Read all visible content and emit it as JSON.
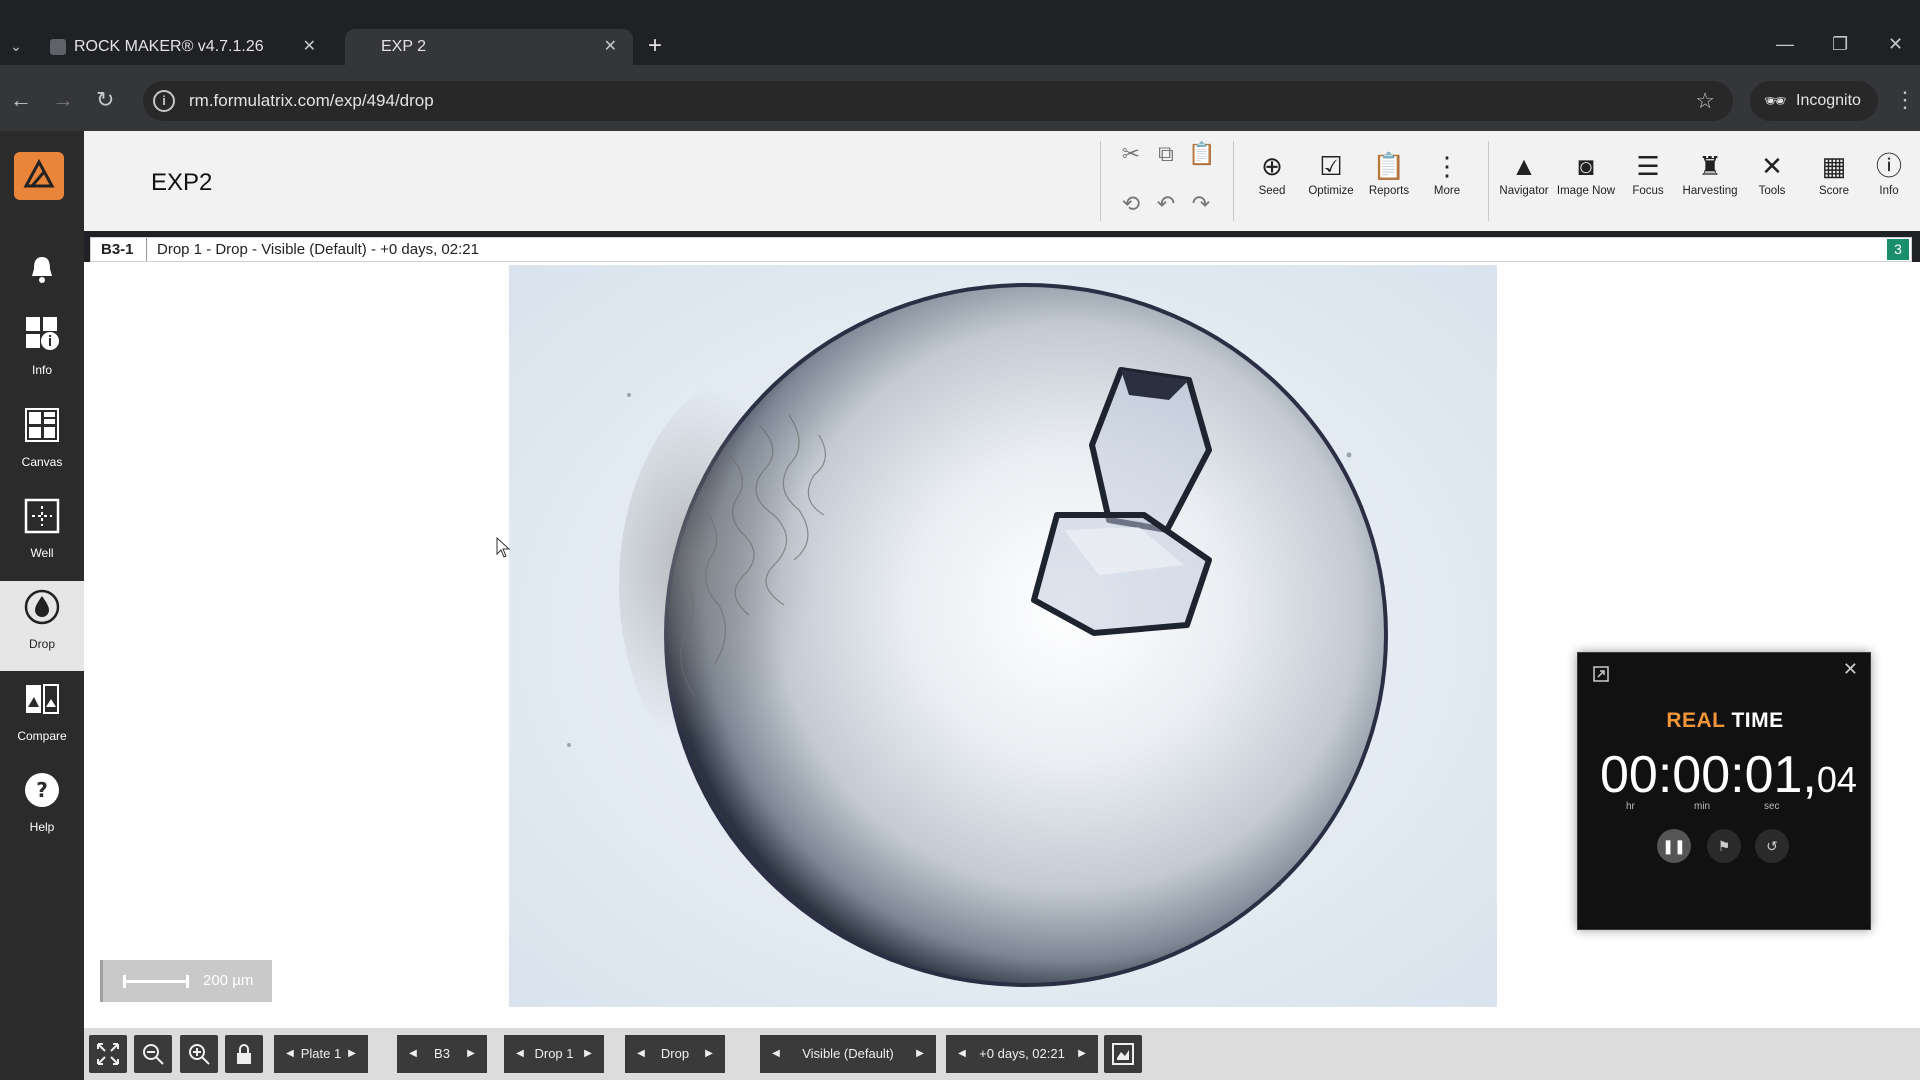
{
  "browser": {
    "tabs": [
      {
        "title": "ROCK MAKER® v4.7.1.26"
      },
      {
        "title": "EXP 2"
      }
    ],
    "url": "rm.formulatrix.com/exp/494/drop",
    "incognito_label": "Incognito"
  },
  "app": {
    "title": "EXP2",
    "sidebar": [
      {
        "label": "",
        "icon": "bell-icon"
      },
      {
        "label": "Info",
        "icon": "info-grid-icon"
      },
      {
        "label": "Canvas",
        "icon": "canvas-icon"
      },
      {
        "label": "Well",
        "icon": "well-icon"
      },
      {
        "label": "Drop",
        "icon": "drop-icon"
      },
      {
        "label": "Compare",
        "icon": "compare-icon"
      },
      {
        "label": "Help",
        "icon": "help-icon"
      }
    ],
    "tools": [
      {
        "label": "Seed",
        "icon": "seed-icon"
      },
      {
        "label": "Optimize",
        "icon": "optimize-icon"
      },
      {
        "label": "Reports",
        "icon": "reports-icon"
      },
      {
        "label": "More",
        "icon": "more-icon"
      },
      {
        "label": "Navigator",
        "icon": "navigator-icon"
      },
      {
        "label": "Image Now",
        "icon": "camera-icon"
      },
      {
        "label": "Focus",
        "icon": "focus-icon"
      },
      {
        "label": "Harvesting",
        "icon": "harvesting-icon"
      },
      {
        "label": "Tools",
        "icon": "tools-icon"
      },
      {
        "label": "Score",
        "icon": "score-icon"
      },
      {
        "label": "Info",
        "icon": "info-icon"
      }
    ],
    "breadcrumb": {
      "well": "B3-1",
      "description": "Drop 1 - Drop - Visible (Default) - +0 days, 02:21",
      "count": "3"
    },
    "scale_label": "200 µm",
    "bottom": {
      "plate": "Plate 1",
      "well": "B3",
      "drop": "Drop 1",
      "type": "Drop",
      "imaging": "Visible (Default)",
      "time": "+0 days, 02:21"
    }
  },
  "timer": {
    "title_accent": "REAL",
    "title_rest": " TIME",
    "main": "00:00:01,",
    "fraction": "04",
    "units": {
      "hr": "hr",
      "min": "min",
      "sec": "sec"
    }
  },
  "colors": {
    "accent": "#f0953a",
    "logo": "#e9853a",
    "badge": "#1b8f6b"
  }
}
